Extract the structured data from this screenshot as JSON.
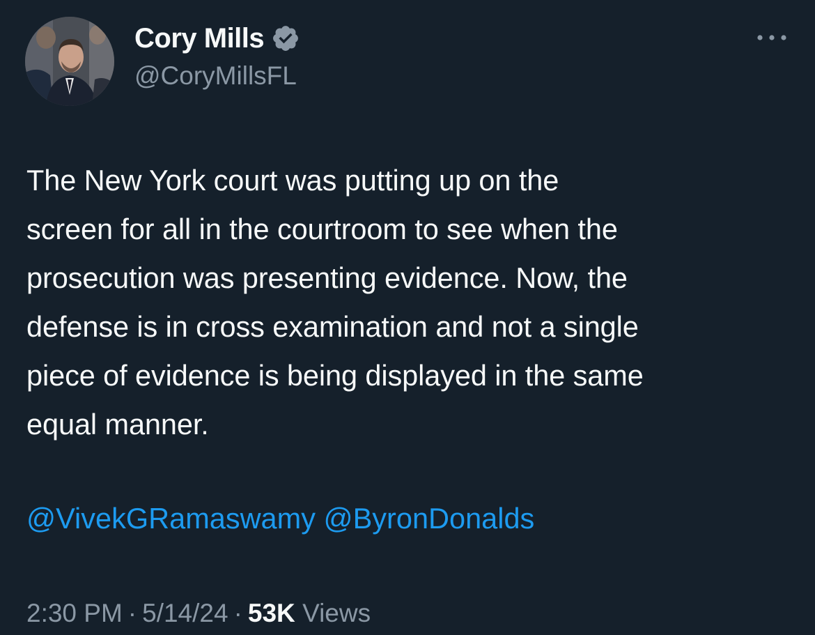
{
  "colors": {
    "background": "#15202b",
    "primary_text": "#f7f9f9",
    "secondary_text": "#8b98a5",
    "link": "#1d9bf0",
    "verified_badge": "#8b98a5"
  },
  "author": {
    "display_name": "Cory Mills",
    "handle": "@CoryMillsFL",
    "verified_icon": "verified-badge-icon",
    "avatar_icon": "profile-photo"
  },
  "more_icon": "more-options-icon",
  "tweet": {
    "text": "The New York court was putting up on the\nscreen for all in the courtroom to see when the\nprosecution was presenting evidence. Now, the\ndefense is in cross examination and not a single\npiece of evidence is being displayed in the same\nequal manner.",
    "mentions": [
      "@VivekGRamaswamy",
      "@ByronDonalds"
    ]
  },
  "meta": {
    "time": "2:30 PM",
    "separator": "·",
    "date": "5/14/24",
    "views_count": "53K",
    "views_label": "Views"
  }
}
